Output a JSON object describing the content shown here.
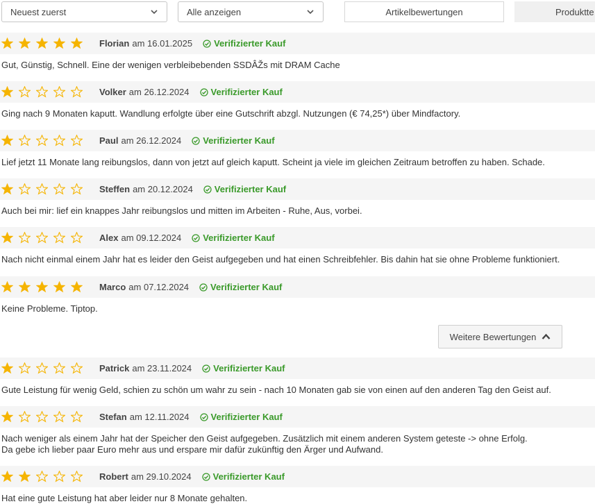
{
  "toolbar": {
    "sort_value": "Neuest zuerst",
    "filter_value": "Alle anzeigen",
    "tab_article": "Artikelbewertungen",
    "tab_product": "Produktte"
  },
  "colors": {
    "star": "#f5b400",
    "verified": "#3a9a2a",
    "header_bg": "#f5f5f5"
  },
  "reviews": [
    {
      "rating": 5,
      "author": "Florian",
      "date": "am 16.01.2025",
      "verified": "Verifizierter Kauf",
      "lines": [
        "Gut, Günstig, Schnell. Eine der wenigen verbleibebenden SSDÂŽs mit DRAM Cache"
      ]
    },
    {
      "rating": 1,
      "author": "Volker",
      "date": "am 26.12.2024",
      "verified": "Verifizierter Kauf",
      "lines": [
        "Ging nach 9 Monaten kaputt. Wandlung erfolgte über eine Gutschrift abzgl. Nutzungen (€ 74,25*) über Mindfactory."
      ]
    },
    {
      "rating": 1,
      "author": "Paul",
      "date": "am 26.12.2024",
      "verified": "Verifizierter Kauf",
      "lines": [
        "Lief jetzt 11 Monate lang reibungslos, dann von jetzt auf gleich kaputt. Scheint ja viele im gleichen Zeitraum betroffen zu haben. Schade."
      ]
    },
    {
      "rating": 1,
      "author": "Steffen",
      "date": "am 20.12.2024",
      "verified": "Verifizierter Kauf",
      "lines": [
        "Auch bei mir: lief ein knappes Jahr reibungslos und mitten im Arbeiten - Ruhe, Aus, vorbei."
      ]
    },
    {
      "rating": 1,
      "author": "Alex",
      "date": "am 09.12.2024",
      "verified": "Verifizierter Kauf",
      "lines": [
        "Nach nicht einmal einem Jahr hat es leider den Geist aufgegeben und hat einen Schreibfehler. Bis dahin hat sie ohne Probleme funktioniert."
      ]
    },
    {
      "rating": 5,
      "author": "Marco",
      "date": "am 07.12.2024",
      "verified": "Verifizierter Kauf",
      "lines": [
        "Keine Probleme. Tiptop."
      ]
    },
    {
      "rating": 1,
      "author": "Patrick",
      "date": "am 23.11.2024",
      "verified": "Verifizierter Kauf",
      "lines": [
        "Gute Leistung für wenig Geld, schien zu schön um wahr zu sein - nach 10 Monaten gab sie von einen auf den anderen Tag den Geist auf."
      ]
    },
    {
      "rating": 1,
      "author": "Stefan",
      "date": "am 12.11.2024",
      "verified": "Verifizierter Kauf",
      "lines": [
        "Nach weniger als einem Jahr hat der Speicher den Geist aufgegeben. Zusätzlich mit einem anderen System geteste -> ohne Erfolg.",
        "Da gebe ich lieber paar Euro mehr aus und erspare mir dafür zukünftig den Ärger und Aufwand."
      ]
    },
    {
      "rating": 2,
      "author": "Robert",
      "date": "am 29.10.2024",
      "verified": "Verifizierter Kauf",
      "lines": [
        "Hat eine gute Leistung hat aber leider nur 8 Monate gehalten."
      ]
    }
  ],
  "more_button": "Weitere Bewertungen"
}
